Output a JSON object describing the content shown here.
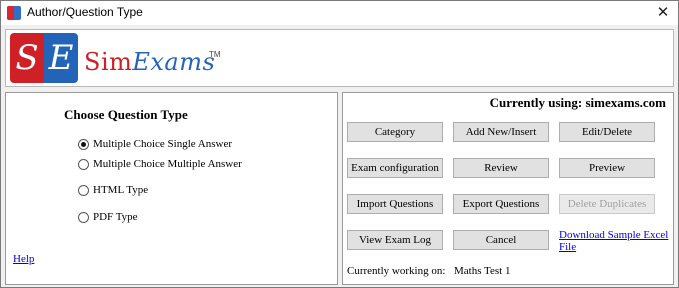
{
  "window": {
    "title": "Author/Question Type",
    "close_glyph": "✕"
  },
  "logo": {
    "mark_left": "S",
    "mark_right": "E",
    "name_part1": "Sim",
    "name_part2": "Exams",
    "trademark": "TM"
  },
  "left_panel": {
    "title": "Choose Question Type",
    "options": [
      {
        "label": "Multiple Choice Single Answer",
        "selected": true
      },
      {
        "label": "Multiple Choice Multiple Answer",
        "selected": false
      },
      {
        "label": "HTML Type",
        "selected": false
      },
      {
        "label": "PDF Type",
        "selected": false
      }
    ],
    "help": "Help"
  },
  "right_panel": {
    "currently_using": "Currently using: simexams.com",
    "buttons": {
      "category": "Category",
      "add_new": "Add New/Insert",
      "edit_delete": "Edit/Delete",
      "exam_config": "Exam configuration",
      "review": "Review",
      "preview": "Preview",
      "import": "Import Questions",
      "export": "Export Questions",
      "delete_duplicates": "Delete Duplicates",
      "view_log": "View Exam Log",
      "cancel": "Cancel"
    },
    "download_link": "Download Sample Excel File",
    "working_on_label": "Currently working on:",
    "working_on_value": "Maths Test 1"
  }
}
